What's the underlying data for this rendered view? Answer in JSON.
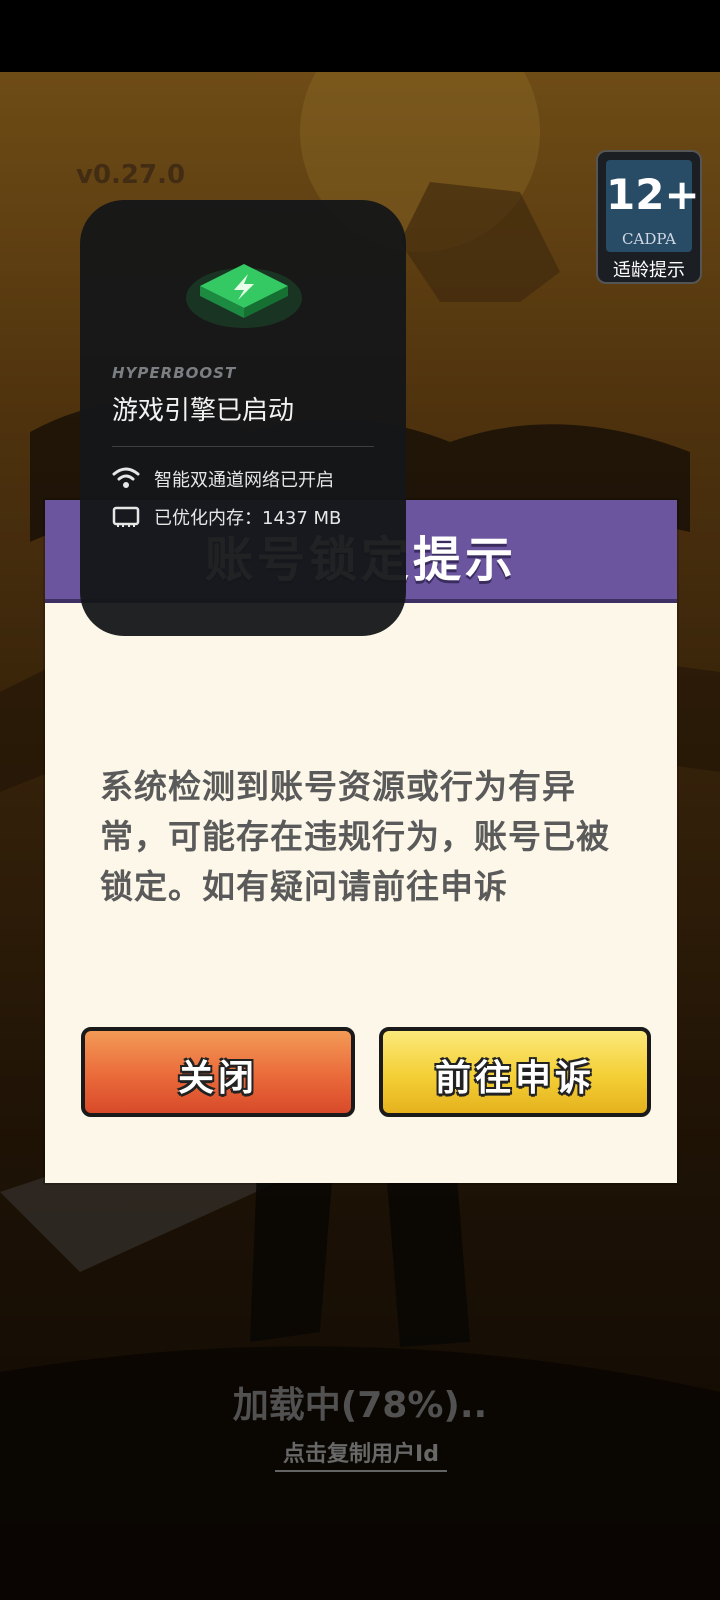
{
  "game": {
    "version": "v0.27.0",
    "age_rating": {
      "number": "12+",
      "org": "CADPA",
      "label": "适龄提示"
    },
    "loading_text": "加载中(78%)..",
    "copy_user_id": "点击复制用户Id"
  },
  "dialog": {
    "title": "账号锁定提示",
    "message": "系统检测到账号资源或行为有异常，可能存在违规行为，账号已被锁定。如有疑问请前往申诉",
    "close_button": "关闭",
    "appeal_button": "前往申诉",
    "colors": {
      "header": "#6a559e",
      "body": "#fcf7e8",
      "close": "#ea6a3a",
      "appeal": "#f4cf35"
    }
  },
  "hyperboost": {
    "brand": "HYPERBOOST",
    "title": "游戏引擎已启动",
    "rows": [
      {
        "icon": "wifi-icon",
        "text": "智能双通道网络已开启"
      },
      {
        "icon": "memory-icon",
        "text": "已优化内存：1437 MB"
      }
    ],
    "accent": "#2fbf5a"
  }
}
